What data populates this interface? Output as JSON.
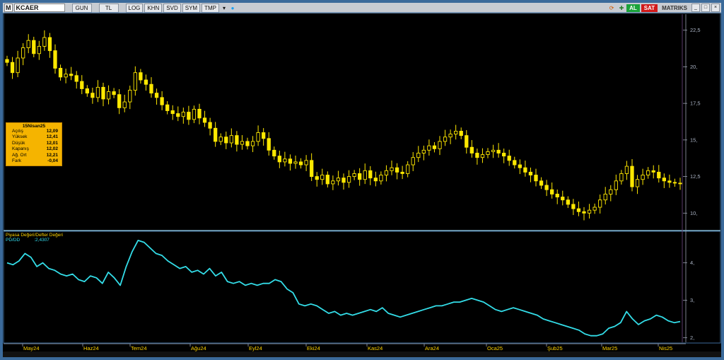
{
  "toolbar": {
    "symbol_prefix": "M",
    "symbol": "KCAER",
    "buttons": [
      "GUN",
      "TL",
      "LOG",
      "KHN",
      "SVD",
      "SYM",
      "TMP"
    ],
    "buy_label": "AL",
    "sell_label": "SAT",
    "brand": "MATRIKS"
  },
  "info_panel": {
    "date": "15Nisan25",
    "rows": [
      {
        "label": "Açılış",
        "value": "12,09"
      },
      {
        "label": "Yüksek",
        "value": "12,41"
      },
      {
        "label": "Düşük",
        "value": "12,01"
      },
      {
        "label": "Kapanış",
        "value": "12,02"
      },
      {
        "label": "Ağ. Ort",
        "value": "12,21"
      },
      {
        "label": "Fark",
        "value": "-0,04"
      }
    ]
  },
  "indicator": {
    "title": "Piyasa Değeri/Defter Değeri",
    "series_name": "PD/DD",
    "value": ":2,4307"
  },
  "colors": {
    "candle": "#ffe800",
    "indicator": "#33dde8",
    "frame": "#3b6a9a",
    "axis": "#9aa0b0"
  },
  "chart_data": [
    {
      "type": "candlestick",
      "ylim": [
        9.0,
        23.5
      ],
      "y_ticks": [
        10,
        12.5,
        15,
        17.5,
        20,
        22.5
      ],
      "y_tick_labels": [
        "10,",
        "12,5",
        "15,",
        "17,5",
        "20,",
        "22,5"
      ],
      "x_tick_labels": [
        "May24",
        "Haz24",
        "Tem24",
        "Ağu24",
        "Eyl24",
        "Eki24",
        "Kas24",
        "Ara24",
        "Oca25",
        "Şub25",
        "Mar25",
        "Nis25"
      ],
      "close": [
        20.3,
        19.6,
        20.6,
        21.3,
        21.8,
        20.9,
        21.4,
        22.0,
        21.1,
        19.9,
        19.3,
        19.5,
        19.4,
        19.0,
        18.5,
        18.2,
        17.9,
        18.6,
        17.8,
        18.3,
        18.1,
        17.2,
        17.6,
        18.4,
        19.6,
        19.1,
        18.8,
        18.2,
        17.9,
        17.4,
        17.0,
        16.8,
        16.6,
        16.9,
        16.4,
        17.1,
        16.5,
        16.2,
        15.8,
        14.9,
        15.2,
        14.8,
        15.3,
        14.7,
        14.9,
        14.6,
        14.9,
        15.5,
        15.1,
        14.3,
        13.9,
        13.5,
        13.7,
        13.4,
        13.5,
        13.3,
        13.6,
        12.5,
        12.3,
        12.6,
        12.0,
        12.2,
        12.4,
        12.1,
        12.5,
        12.7,
        12.3,
        12.9,
        12.4,
        12.2,
        12.6,
        12.9,
        13.1,
        12.8,
        12.7,
        13.3,
        13.8,
        14.1,
        14.3,
        14.6,
        14.4,
        14.9,
        15.2,
        15.4,
        15.6,
        15.3,
        14.5,
        14.1,
        13.8,
        14.0,
        14.2,
        14.3,
        14.1,
        13.9,
        13.6,
        13.3,
        13.1,
        12.8,
        12.6,
        12.2,
        11.9,
        11.6,
        11.3,
        11.1,
        10.9,
        10.6,
        10.3,
        10.1,
        10.0,
        10.2,
        10.4,
        10.9,
        11.3,
        11.6,
        12.2,
        12.7,
        13.2,
        11.8,
        12.3,
        12.6,
        12.9,
        12.8,
        12.4,
        12.2,
        12.1,
        12.05,
        12.02
      ]
    },
    {
      "type": "line",
      "name": "PD/DD",
      "ylim": [
        1.95,
        4.75
      ],
      "y_ticks": [
        2,
        3,
        4
      ],
      "y_tick_labels": [
        "2,",
        "3,",
        "4,"
      ],
      "values": [
        4.0,
        3.95,
        4.05,
        4.25,
        4.15,
        3.9,
        4.0,
        3.85,
        3.8,
        3.7,
        3.65,
        3.7,
        3.55,
        3.5,
        3.65,
        3.6,
        3.45,
        3.75,
        3.6,
        3.4,
        3.9,
        4.3,
        4.6,
        4.55,
        4.4,
        4.25,
        4.2,
        4.05,
        3.95,
        3.85,
        3.9,
        3.75,
        3.8,
        3.7,
        3.85,
        3.65,
        3.75,
        3.5,
        3.45,
        3.5,
        3.4,
        3.45,
        3.4,
        3.45,
        3.45,
        3.55,
        3.5,
        3.3,
        3.2,
        2.9,
        2.85,
        2.9,
        2.85,
        2.75,
        2.65,
        2.7,
        2.6,
        2.65,
        2.6,
        2.65,
        2.7,
        2.75,
        2.7,
        2.8,
        2.65,
        2.6,
        2.55,
        2.6,
        2.65,
        2.7,
        2.75,
        2.8,
        2.85,
        2.85,
        2.9,
        2.95,
        2.95,
        3.0,
        3.05,
        3.0,
        2.95,
        2.85,
        2.75,
        2.7,
        2.75,
        2.8,
        2.75,
        2.7,
        2.65,
        2.6,
        2.5,
        2.45,
        2.4,
        2.35,
        2.3,
        2.25,
        2.2,
        2.1,
        2.05,
        2.05,
        2.1,
        2.25,
        2.3,
        2.4,
        2.7,
        2.5,
        2.35,
        2.45,
        2.5,
        2.6,
        2.55,
        2.45,
        2.4,
        2.43
      ]
    }
  ]
}
